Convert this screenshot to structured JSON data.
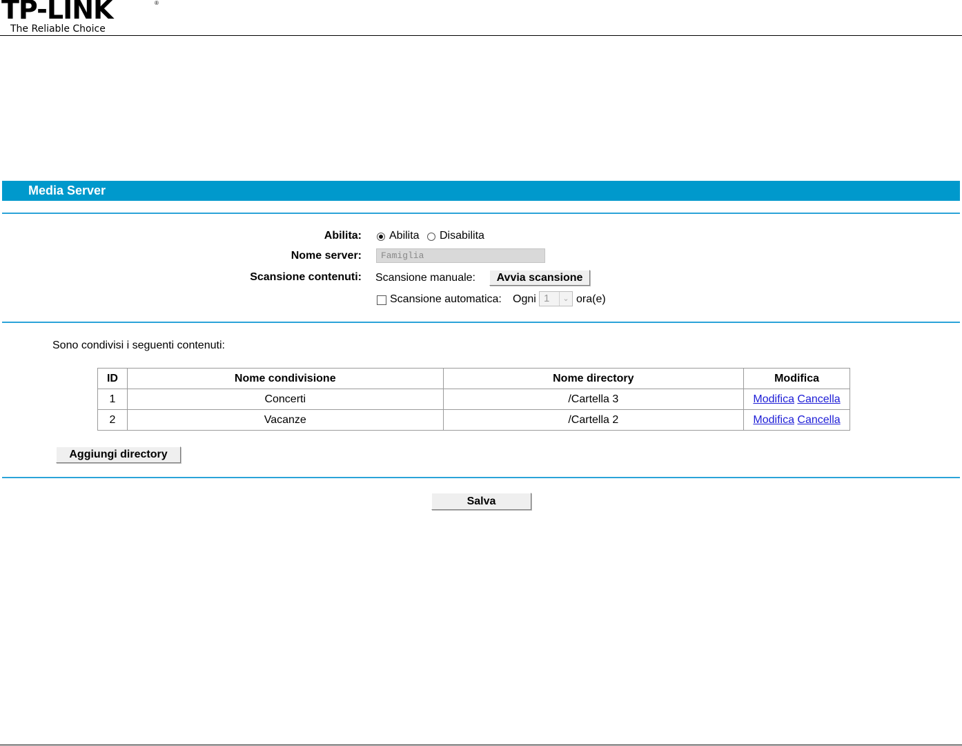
{
  "brand": {
    "name": "TP-LINK",
    "registered": "®",
    "tagline": "The Reliable Choice"
  },
  "section_title": "Media Server",
  "form": {
    "enable_label": "Abilita:",
    "enable_options": [
      "Abilita",
      "Disabilita"
    ],
    "enable_selected": "Abilita",
    "server_name_label": "Nome server:",
    "server_name_value": "Famiglia",
    "scan_label": "Scansione contenuti:",
    "manual_scan_label": "Scansione manuale:",
    "manual_scan_button": "Avvia scansione",
    "auto_scan_label": "Scansione automatica:",
    "auto_scan_checked": false,
    "every_label": "Ogni",
    "interval_value": "1",
    "interval_unit": "ora(e)"
  },
  "shared": {
    "intro": "Sono condivisi i seguenti contenuti:",
    "columns": [
      "ID",
      "Nome condivisione",
      "Nome directory",
      "Modifica"
    ],
    "rows": [
      {
        "id": "1",
        "share": "Concerti",
        "directory": "/Cartella 3",
        "edit": "Modifica",
        "delete": "Cancella"
      },
      {
        "id": "2",
        "share": "Vacanze",
        "directory": "/Cartella 2",
        "edit": "Modifica",
        "delete": "Cancella"
      }
    ],
    "add_button": "Aggiungi directory"
  },
  "save_button": "Salva",
  "colors": {
    "accent": "#0099cc",
    "rule": "#2aa3d8",
    "link": "#1c1cd6"
  },
  "icons": {
    "interval_dropdown": "chevron-down-icon"
  }
}
